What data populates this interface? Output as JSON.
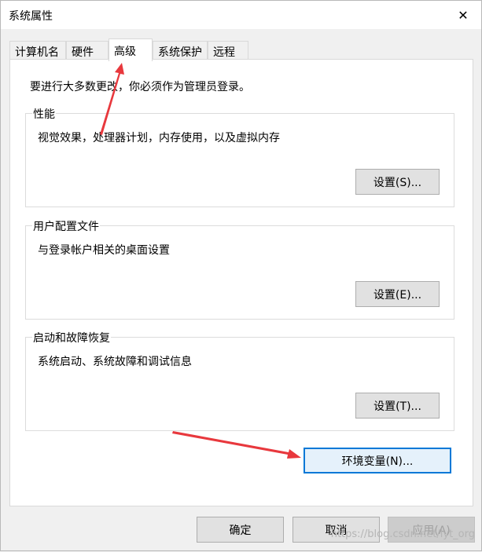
{
  "window": {
    "title": "系统属性",
    "close_glyph": "✕"
  },
  "tabs": [
    {
      "label": "计算机名"
    },
    {
      "label": "硬件"
    },
    {
      "label": "高级"
    },
    {
      "label": "系统保护"
    },
    {
      "label": "远程"
    }
  ],
  "active_tab": "高级",
  "panel": {
    "notice": "要进行大多数更改，你必须作为管理员登录。",
    "groups": [
      {
        "title": "性能",
        "description": "视觉效果，处理器计划，内存使用，以及虚拟内存",
        "button": "设置(S)..."
      },
      {
        "title": "用户配置文件",
        "description": "与登录帐户相关的桌面设置",
        "button": "设置(E)..."
      },
      {
        "title": "启动和故障恢复",
        "description": "系统启动、系统故障和调试信息",
        "button": "设置(T)..."
      }
    ],
    "env_button": "环境变量(N)..."
  },
  "footer": {
    "ok": "确定",
    "cancel": "取消",
    "apply": "应用(A)"
  },
  "watermark": "https://blog.csdn.net/lyt_org",
  "annotation_color": "#e8383d"
}
